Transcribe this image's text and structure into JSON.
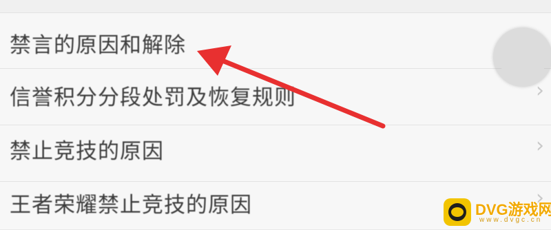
{
  "menu": {
    "items": [
      {
        "label": "禁言的原因和解除",
        "chevron_icon": "chevron-right-icon"
      },
      {
        "label": "信誉积分分段处罚及恢复规则",
        "chevron": "›"
      },
      {
        "label": "禁止竞技的原因",
        "chevron": "›"
      },
      {
        "label": "王者荣耀禁止竞技的原因",
        "chevron": "›"
      }
    ]
  },
  "annotation": {
    "arrow_color": "#e83030",
    "touch_indicator": "touch-indicator-icon"
  },
  "watermark": {
    "brand": "DVG游戏网",
    "url": "www.dvgc.cn",
    "logo_color": "#f2c400"
  }
}
